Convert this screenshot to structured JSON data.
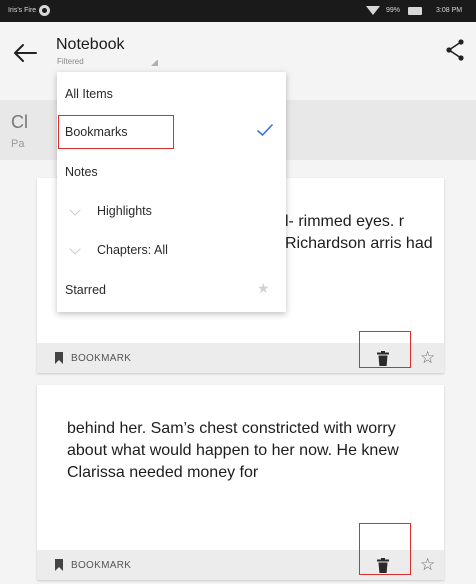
{
  "status_bar": {
    "carrier": "Iris's Fire",
    "battery": "99%",
    "time": "3:08 PM"
  },
  "app_bar": {
    "title": "Notebook",
    "subtitle": "Filtered"
  },
  "section": {
    "title": "Cl",
    "subtitle": "Pa"
  },
  "menu": {
    "items": [
      {
        "label": "All Items"
      },
      {
        "label": "Bookmarks",
        "selected": true
      },
      {
        "label": "Notes"
      },
      {
        "label": "Highlights"
      },
      {
        "label": "Chapters: All"
      },
      {
        "label": "Starred"
      }
    ]
  },
  "cards": [
    {
      "excerpt": "l- rimmed eyes. r Richardson arris had",
      "kind": "BOOKMARK"
    },
    {
      "excerpt": "behind her. Sam’s chest constricted with worry about what would happen to her now. He knew Clarissa needed money for",
      "kind": "BOOKMARK"
    }
  ],
  "colors": {
    "accent": "#3a78d4",
    "highlight_box": "#d92f2f"
  }
}
